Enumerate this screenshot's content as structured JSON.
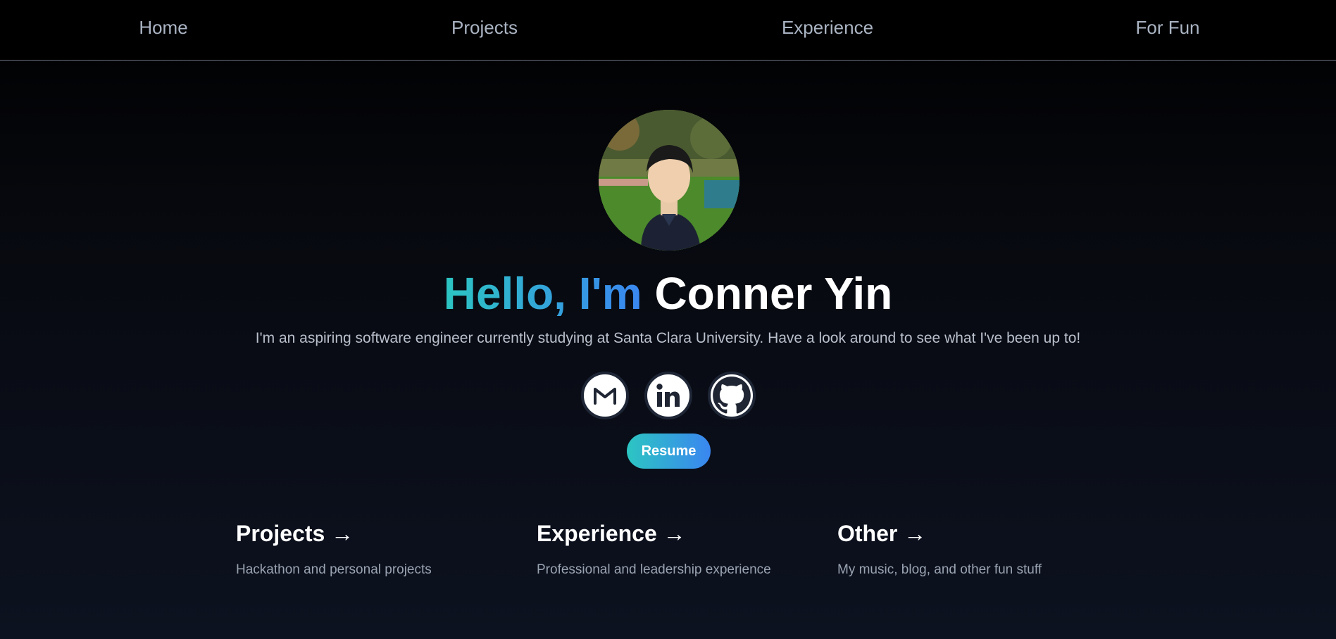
{
  "nav": {
    "items": [
      {
        "label": "Home"
      },
      {
        "label": "Projects"
      },
      {
        "label": "Experience"
      },
      {
        "label": "For Fun"
      }
    ]
  },
  "hero": {
    "greeting": "Hello, I'm",
    "name": "Conner Yin",
    "subtitle": "I'm an aspiring software engineer currently studying at Santa Clara University. Have a look around to see what I've been up to!",
    "resume_label": "Resume"
  },
  "social": {
    "icons": [
      "gmail-icon",
      "linkedin-icon",
      "github-icon"
    ]
  },
  "cards": [
    {
      "title": "Projects →",
      "description": "Hackathon and personal projects"
    },
    {
      "title": "Experience →",
      "description": "Professional and leadership experience"
    },
    {
      "title": "Other →",
      "description": "My music, blog, and other fun stuff"
    }
  ],
  "colors": {
    "gradient_start": "#2cc5c2",
    "gradient_end": "#3a86f0",
    "background": "#0d1220",
    "nav_text": "#aab4c3"
  }
}
